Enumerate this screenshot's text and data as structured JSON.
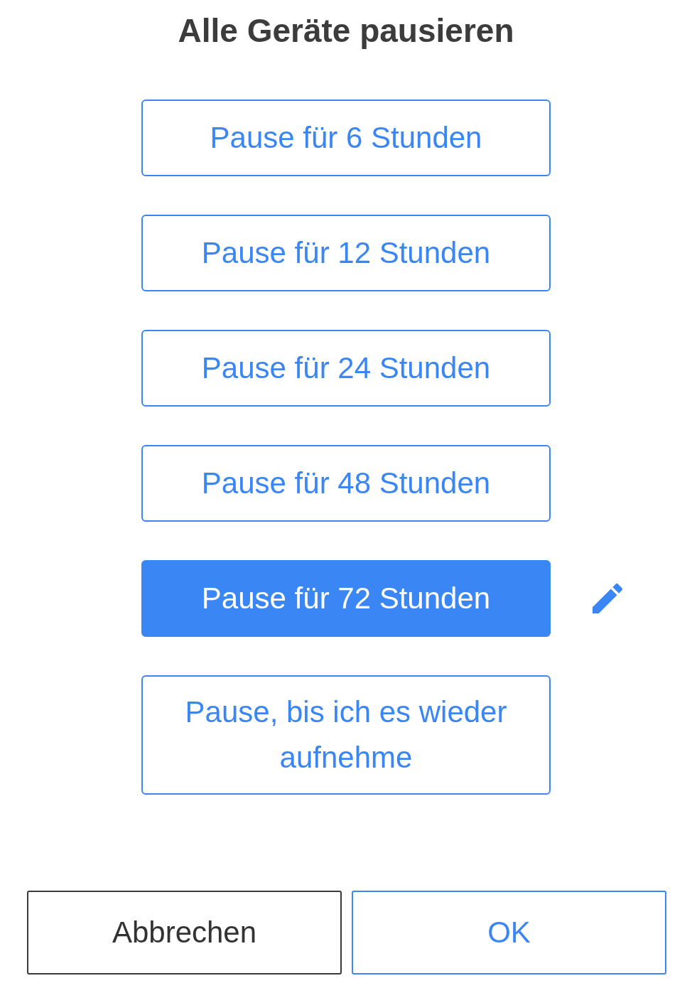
{
  "title": "Alle Geräte pausieren",
  "options": [
    {
      "label": "Pause für 6 Stunden",
      "selected": false
    },
    {
      "label": "Pause für 12 Stunden",
      "selected": false
    },
    {
      "label": "Pause für 24 Stunden",
      "selected": false
    },
    {
      "label": "Pause für 48 Stunden",
      "selected": false
    },
    {
      "label": "Pause für 72 Stunden",
      "selected": true
    },
    {
      "label": "Pause, bis ich es wieder aufnehme",
      "selected": false
    }
  ],
  "buttons": [
    {
      "label": "Abbrechen",
      "kind": "cancel"
    },
    {
      "label": "OK",
      "kind": "confirm"
    }
  ]
}
